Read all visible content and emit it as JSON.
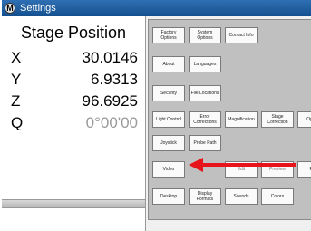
{
  "window": {
    "title": "Settings",
    "app_icon": "M"
  },
  "stage": {
    "title": "Stage Position",
    "axes": [
      {
        "label": "X",
        "value": "30.0146"
      },
      {
        "label": "Y",
        "value": "6.9313"
      },
      {
        "label": "Z",
        "value": "96.6925"
      },
      {
        "label": "Q",
        "value": "0°00'00"
      }
    ]
  },
  "settings_buttons": {
    "factory_options": "Factory Options",
    "system_options": "System Options",
    "contact_info": "Contact Info",
    "about": "About",
    "languages": "Languages",
    "security": "Security",
    "file_locations": "File Locations",
    "light_control": "Light Control",
    "error_corrections": "Error Corrections",
    "magnification": "Magnification",
    "stage_correction": "Stage Correction",
    "op_partial": "Op Set",
    "joystick": "Joystick",
    "probe_path": "Probe Path",
    "video": "Video",
    "hidden_1": "Edit",
    "hidden_2": "Preview",
    "print_partial": "Prin",
    "desktop": "Desktop",
    "display_formats": "Display Formats",
    "sounds": "Sounds",
    "colors": "Colors"
  },
  "annotation": {
    "arrow_color": "#e8141c"
  }
}
